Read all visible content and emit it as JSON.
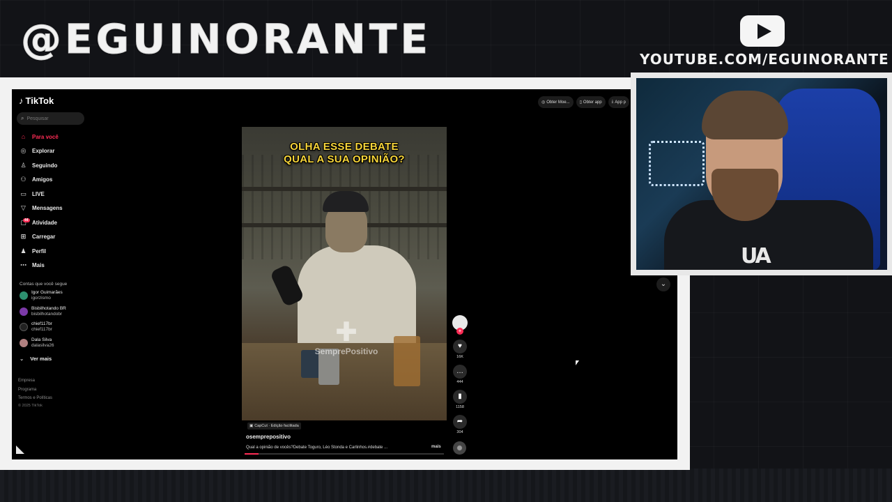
{
  "overlay": {
    "handle": "@EGUINORANTE",
    "youtube_url": "YOUTUBE.COM/EGUINORANTE"
  },
  "tiktok": {
    "logo": "TikTok",
    "search_placeholder": "Pesquisar",
    "nav": [
      {
        "label": "Para você",
        "icon": "home-icon",
        "active": true
      },
      {
        "label": "Explorar",
        "icon": "compass-icon"
      },
      {
        "label": "Seguindo",
        "icon": "following-icon"
      },
      {
        "label": "Amigos",
        "icon": "friends-icon"
      },
      {
        "label": "LIVE",
        "icon": "live-icon"
      },
      {
        "label": "Mensagens",
        "icon": "messages-icon"
      },
      {
        "label": "Atividade",
        "icon": "activity-icon",
        "badge": "44"
      },
      {
        "label": "Carregar",
        "icon": "upload-icon"
      },
      {
        "label": "Perfil",
        "icon": "profile-icon"
      },
      {
        "label": "Mais",
        "icon": "more-icon"
      }
    ],
    "following_title": "Contas que você segue",
    "following": [
      {
        "name": "Igor Guimarães",
        "user": "igorzismo",
        "color": "#2d8f6f"
      },
      {
        "name": "Bisbilhotando BR",
        "user": "bisbilhotandobr",
        "color": "#7c3aa8"
      },
      {
        "name": "chief117br",
        "user": "chief117br",
        "color": "#222222"
      },
      {
        "name": "Dala Silva",
        "user": "dalasilva26",
        "color": "#b08080"
      }
    ],
    "see_more": "Ver mais",
    "footer": {
      "company": "Empresa",
      "program": "Programa",
      "terms": "Termos e Políticas",
      "copyright": "© 2025 TikTok"
    },
    "top_buttons": {
      "coins": "Obter Moe...",
      "get_app": "Obter app",
      "pc_app": "App p"
    },
    "video": {
      "caption_line1": "OLHA ESSE DEBATE",
      "caption_line2": "QUAL A SUA OPINIÃO?",
      "watermark": "SemprePositivo",
      "capcut_tag": "CapCut · Edição facilitada",
      "author": "osemprepositivo",
      "description": "Qual a opinião de vocês?Debate Toguro, Léo Stonda e Carlinhos.#debate ...",
      "more": "mais",
      "progress": 0.07
    },
    "actions": {
      "likes": "16K",
      "comments": "444",
      "saves": "1158",
      "shares": "304"
    }
  }
}
